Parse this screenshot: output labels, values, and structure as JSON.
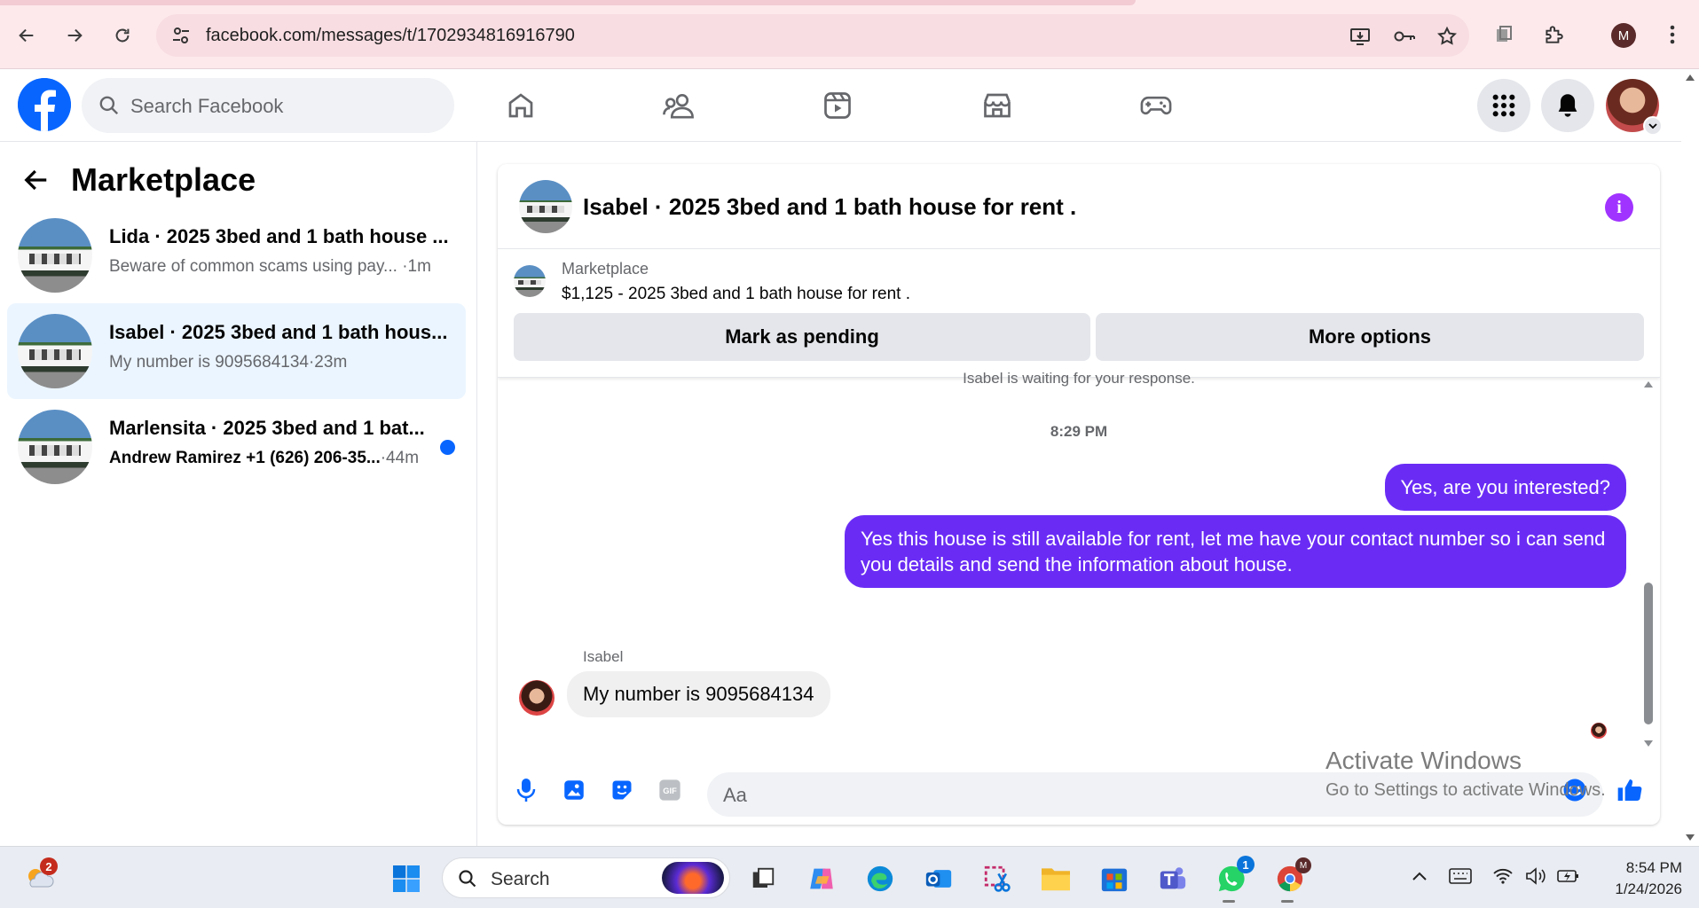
{
  "browser": {
    "url": "facebook.com/messages/t/1702934816916790",
    "profile_initial": "M"
  },
  "header": {
    "search_placeholder": "Search Facebook"
  },
  "sidebar": {
    "title": "Marketplace",
    "conversations": [
      {
        "name": "Lida · 2025 3bed and 1 bath house ...",
        "preview": "Beware of common scams using pay...",
        "time": "·1m",
        "unread": false,
        "active": false
      },
      {
        "name": "Isabel · 2025 3bed and 1 bath hous...",
        "preview": "My number is 9095684134",
        "time": "·23m",
        "unread": false,
        "active": true
      },
      {
        "name": "Marlensita · 2025 3bed and 1 bat...",
        "preview": "Andrew Ramirez +1 (626) 206-35...",
        "time": "·44m",
        "unread": true,
        "active": false
      }
    ]
  },
  "chat": {
    "title": "Isabel · 2025 3bed and 1 bath house for rent .",
    "marketplace_label": "Marketplace",
    "listing": "$1,125 - 2025 3bed and 1 bath house for rent .",
    "mark_pending": "Mark as pending",
    "more_options": "More options",
    "waiting_notice": "Isabel is waiting for your response.",
    "timestamp": "8:29 PM",
    "messages": [
      {
        "from": "me",
        "text": "Yes, are you interested?"
      },
      {
        "from": "me",
        "text": "Yes this house is still available for rent, let me have your contact number so i can send you details and send the information about house."
      },
      {
        "from": "Isabel",
        "sender_label": "Isabel",
        "text": "My number is 9095684134"
      }
    ],
    "composer_placeholder": "Aa"
  },
  "watermark": {
    "line1": "Activate Windows",
    "line2": "Go to Settings to activate Windows."
  },
  "taskbar": {
    "search_placeholder": "Search",
    "weather_badge": "2",
    "whatsapp_badge": "1",
    "time": "8:54 PM",
    "date": "1/24/2026"
  },
  "colors": {
    "fb_blue": "#0866ff",
    "outgoing_bubble": "#6a2cf5",
    "info_icon": "#a033ff"
  }
}
